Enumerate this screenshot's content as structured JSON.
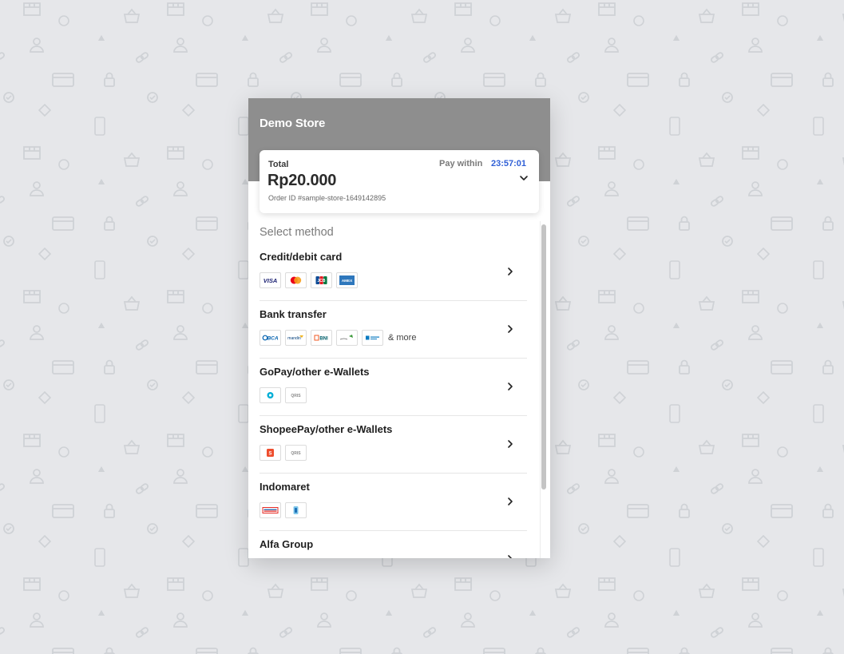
{
  "store": {
    "name": "Demo Store"
  },
  "summary": {
    "total_label": "Total",
    "amount": "Rp20.000",
    "order_id": "Order ID #sample-store-1649142895",
    "pay_within_label": "Pay within",
    "countdown": "23:57:01"
  },
  "methods_title": "Select method",
  "methods": [
    {
      "name": "Credit/debit card",
      "logos": [
        {
          "label": "VISA",
          "icon": "visa-logo"
        },
        {
          "label": "",
          "icon": "mastercard-logo"
        },
        {
          "label": "JCB",
          "icon": "jcb-logo"
        },
        {
          "label": "AMEX",
          "icon": "amex-logo"
        }
      ]
    },
    {
      "name": "Bank transfer",
      "more": "& more",
      "logos": [
        {
          "label": "BCA",
          "icon": "bca-logo"
        },
        {
          "label": "mandiri",
          "icon": "mandiri-logo"
        },
        {
          "label": "BNI",
          "icon": "bni-logo"
        },
        {
          "label": "",
          "icon": "bank-logo"
        },
        {
          "label": "",
          "icon": "bank-logo"
        }
      ]
    },
    {
      "name": "GoPay/other e-Wallets",
      "logos": [
        {
          "label": "",
          "icon": "gopay-logo"
        },
        {
          "label": "QRIS",
          "icon": "qris-logo"
        }
      ]
    },
    {
      "name": "ShopeePay/other e-Wallets",
      "logos": [
        {
          "label": "S",
          "icon": "shopeepay-logo"
        },
        {
          "label": "QRIS",
          "icon": "qris-logo"
        }
      ]
    },
    {
      "name": "Indomaret",
      "logos": [
        {
          "label": "",
          "icon": "indomaret-logo"
        },
        {
          "label": "",
          "icon": "isaku-logo"
        }
      ]
    },
    {
      "name": "Alfa Group",
      "logos": []
    }
  ],
  "colors": {
    "header_bg": "#8e8e8e",
    "timer": "#2f5fd6",
    "page_bg": "#e6e7ea"
  }
}
